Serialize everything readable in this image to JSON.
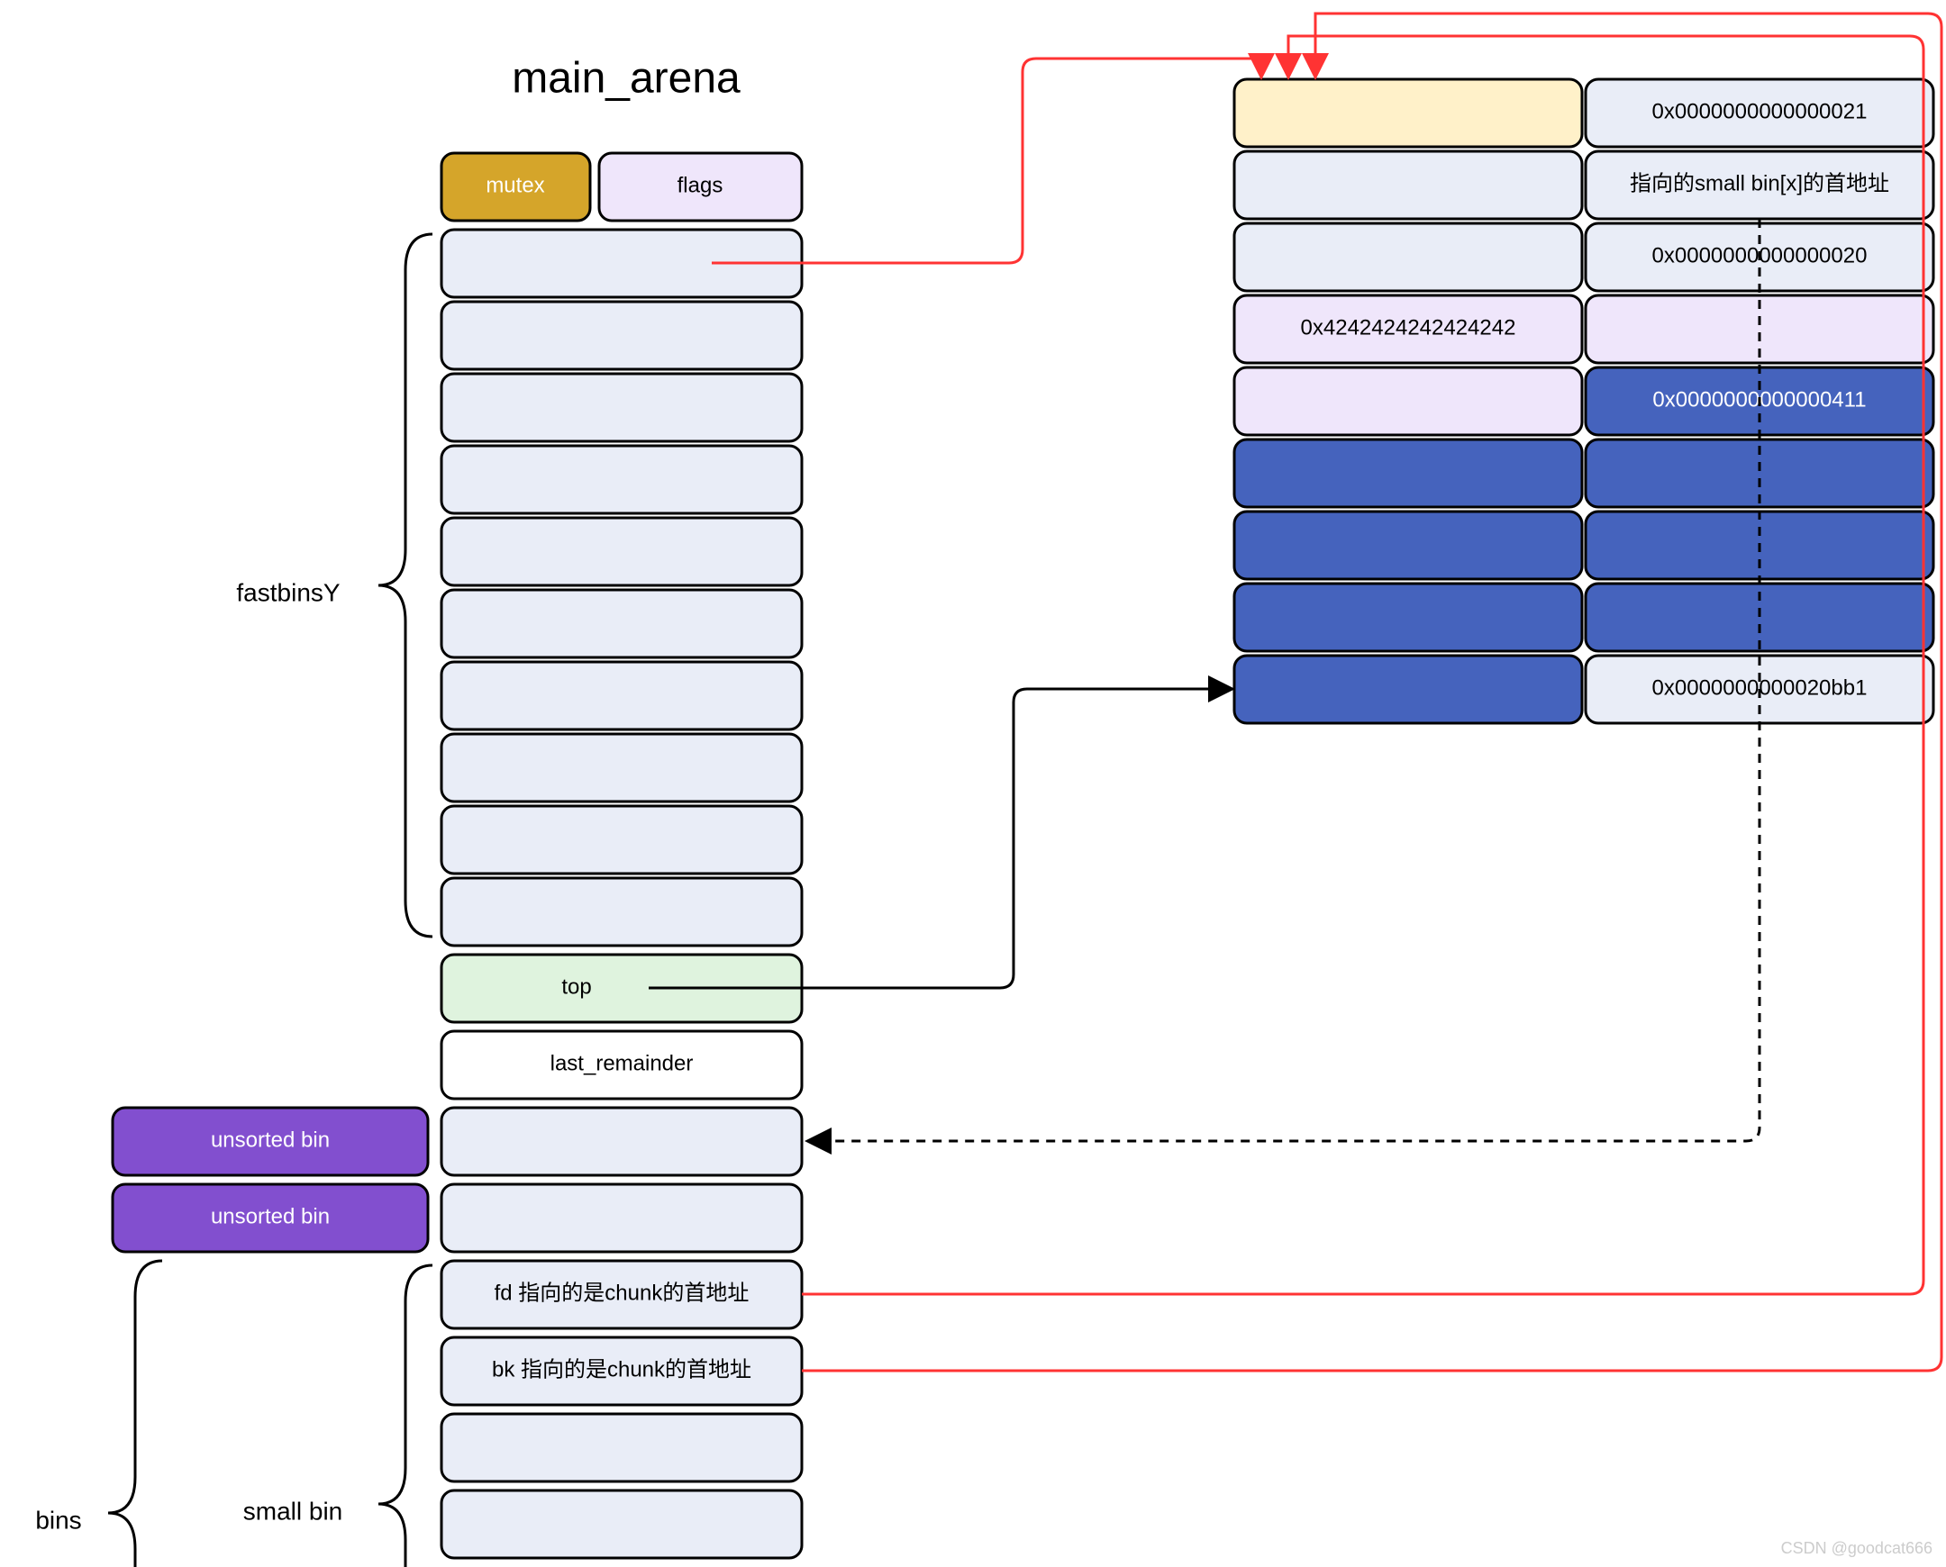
{
  "title": "main_arena",
  "arena": {
    "mutex_label": "mutex",
    "flags_label": "flags",
    "fastbinsY_label": "fastbinsY",
    "top_label": "top",
    "last_remainder_label": "last_remainder",
    "unsorted_bin_label": "unsorted bin",
    "bins_label": "bins",
    "small_bin_label": "small bin",
    "fd_label": "fd 指向的是chunk的首地址",
    "bk_label": "bk 指向的是chunk的首地址"
  },
  "chunk": {
    "row0_right": "0x0000000000000021",
    "row1_right": "指向的small bin[x]的首地址",
    "row2_right": "0x0000000000000020",
    "row3_left": "0x4242424242424242",
    "row4_right": "0x0000000000000411",
    "row8_right": "0x0000000000020bb1"
  },
  "watermark": "CSDN @goodcat666"
}
